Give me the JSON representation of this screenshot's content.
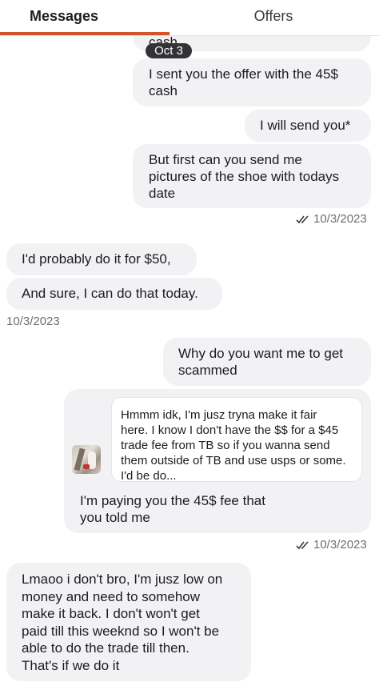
{
  "tabs": {
    "messages": "Messages",
    "offers": "Offers"
  },
  "thread": {
    "partial_top": "cash",
    "date_separator": "Oct 3",
    "sent1": [
      "I sent you the offer with the 45$",
      "cash"
    ],
    "sent2": "I will send you*",
    "sent3": [
      "But first can you send me",
      "pictures of the shoe with todays",
      "date"
    ],
    "status1": "10/3/2023",
    "recv1": "I'd probably do it for $50,",
    "recv2": "And sure, I can do that today.",
    "recv_time": "10/3/2023",
    "sent4": [
      "Why do you want me to get",
      "scammed"
    ],
    "quoted": [
      "Hmmm idk, I'm jusz tryna make it fair",
      "here. I know I don't have the $$ for a $45",
      "trade fee from TB so if you wanna send",
      "them outside of TB and use usps or some.",
      "I'd be do..."
    ],
    "sent5": [
      "I'm paying you the 45$ fee that",
      "you told me"
    ],
    "status2": "10/3/2023",
    "recv3": [
      "Lmaoo i don't bro, I'm jusz low on",
      "money and need to somehow",
      "make it back. I don't won't get",
      "paid till this weeknd so I won't be",
      "able to do the trade till then.",
      "That's if we do it"
    ]
  },
  "icons": {
    "read_receipt": "double-check-icon",
    "thumbnail": "shoe-thumbnail"
  },
  "colors": {
    "accent": "#d4532b",
    "bubble": "#f2f2f4",
    "pill": "#333336"
  }
}
